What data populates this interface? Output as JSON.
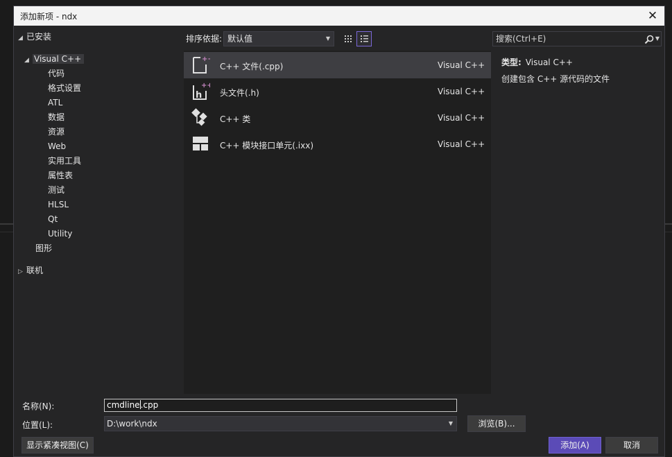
{
  "window": {
    "title": "添加新项 - ndx"
  },
  "tree": {
    "installed_label": "已安装",
    "visual_cpp_label": "Visual C++",
    "children": [
      "代码",
      "格式设置",
      "ATL",
      "数据",
      "资源",
      "Web",
      "实用工具",
      "属性表",
      "测试",
      "HLSL",
      "Qt",
      "Utility"
    ],
    "graphics_label": "图形",
    "online_label": "联机"
  },
  "toolbar": {
    "sort_label": "排序依据:",
    "sort_value": "默认值"
  },
  "items": [
    {
      "name": "C++ 文件(.cpp)",
      "type": "Visual C++",
      "icon": "cpp-file-icon",
      "selected": true
    },
    {
      "name": "头文件(.h)",
      "type": "Visual C++",
      "icon": "header-file-icon",
      "selected": false
    },
    {
      "name": "C++ 类",
      "type": "Visual C++",
      "icon": "class-icon",
      "selected": false
    },
    {
      "name": "C++ 模块接口单元(.ixx)",
      "type": "Visual C++",
      "icon": "module-icon",
      "selected": false
    }
  ],
  "search": {
    "placeholder": "搜索(Ctrl+E)"
  },
  "details": {
    "type_label": "类型:",
    "type_value": "Visual C++",
    "description": "创建包含 C++ 源代码的文件"
  },
  "bottom": {
    "name_label": "名称(N):",
    "name_value_before_caret": "cmdline",
    "name_value_after_caret": ".cpp",
    "location_label": "位置(L):",
    "location_value": "D:\\work\\ndx",
    "browse_label": "浏览(B)...",
    "compact_label": "显示紧凑视图(C)",
    "add_label": "添加(A)",
    "cancel_label": "取消"
  },
  "colors": {
    "accent": "#5b4bb7",
    "icon_plus": "#c586c0",
    "selection": "#3e3e42"
  }
}
